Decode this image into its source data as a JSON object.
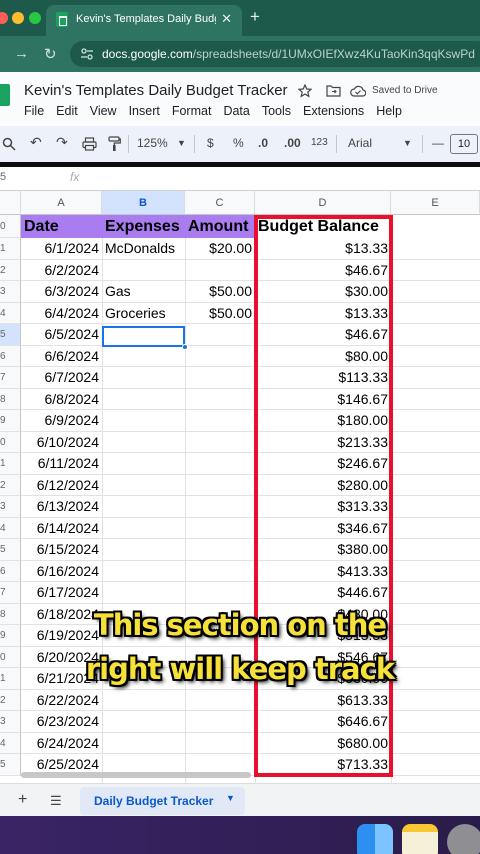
{
  "browser": {
    "tab_title": "Kevin's Templates Daily Budg",
    "tab_close": "✕",
    "new_tab": "+",
    "url_host": "docs.google.com",
    "url_path": "/spreadsheets/d/1UMxOIEfXwz4KuTaoKin3qqKswPd"
  },
  "doc": {
    "title": "Kevin's Templates Daily Budget Tracker",
    "saved_status": "Saved to Drive",
    "menu": [
      "File",
      "Edit",
      "View",
      "Insert",
      "Format",
      "Data",
      "Tools",
      "Extensions",
      "Help"
    ]
  },
  "toolbar": {
    "zoom": "125%",
    "currency": "$",
    "percent": "%",
    "decrease_decimal": ".0",
    "increase_decimal": ".00",
    "number_format": "123",
    "font": "Arial",
    "minus": "—",
    "font_size": "10"
  },
  "formula_bar": {
    "cell_ref": "5",
    "fx": "fx"
  },
  "sheet": {
    "columns": [
      "A",
      "B",
      "C",
      "D",
      "E"
    ],
    "row_numbers": [
      "0",
      "1",
      "2",
      "3",
      "4",
      "5",
      "6",
      "7",
      "8",
      "9",
      "0",
      "1",
      "2",
      "3",
      "4",
      "5",
      "6",
      "7",
      "8",
      "9",
      "0",
      "1",
      "2",
      "3",
      "4",
      "5"
    ],
    "headers": [
      "Date",
      "Expenses",
      "Amount",
      "Budget Balance"
    ],
    "rows": [
      {
        "date": "6/1/2024",
        "expense": "McDonalds",
        "amount": "$20.00",
        "balance": "$13.33"
      },
      {
        "date": "6/2/2024",
        "expense": "",
        "amount": "",
        "balance": "$46.67"
      },
      {
        "date": "6/3/2024",
        "expense": "Gas",
        "amount": "$50.00",
        "balance": "$30.00"
      },
      {
        "date": "6/4/2024",
        "expense": "Groceries",
        "amount": "$50.00",
        "balance": "$13.33"
      },
      {
        "date": "6/5/2024",
        "expense": "",
        "amount": "",
        "balance": "$46.67"
      },
      {
        "date": "6/6/2024",
        "expense": "",
        "amount": "",
        "balance": "$80.00"
      },
      {
        "date": "6/7/2024",
        "expense": "",
        "amount": "",
        "balance": "$113.33"
      },
      {
        "date": "6/8/2024",
        "expense": "",
        "amount": "",
        "balance": "$146.67"
      },
      {
        "date": "6/9/2024",
        "expense": "",
        "amount": "",
        "balance": "$180.00"
      },
      {
        "date": "6/10/2024",
        "expense": "",
        "amount": "",
        "balance": "$213.33"
      },
      {
        "date": "6/11/2024",
        "expense": "",
        "amount": "",
        "balance": "$246.67"
      },
      {
        "date": "6/12/2024",
        "expense": "",
        "amount": "",
        "balance": "$280.00"
      },
      {
        "date": "6/13/2024",
        "expense": "",
        "amount": "",
        "balance": "$313.33"
      },
      {
        "date": "6/14/2024",
        "expense": "",
        "amount": "",
        "balance": "$346.67"
      },
      {
        "date": "6/15/2024",
        "expense": "",
        "amount": "",
        "balance": "$380.00"
      },
      {
        "date": "6/16/2024",
        "expense": "",
        "amount": "",
        "balance": "$413.33"
      },
      {
        "date": "6/17/2024",
        "expense": "",
        "amount": "",
        "balance": "$446.67"
      },
      {
        "date": "6/18/2024",
        "expense": "",
        "amount": "",
        "balance": "$480.00"
      },
      {
        "date": "6/19/2024",
        "expense": "",
        "amount": "",
        "balance": "$513.33"
      },
      {
        "date": "6/20/2024",
        "expense": "",
        "amount": "",
        "balance": "$546.67"
      },
      {
        "date": "6/21/2024",
        "expense": "",
        "amount": "",
        "balance": "$580.00"
      },
      {
        "date": "6/22/2024",
        "expense": "",
        "amount": "",
        "balance": "$613.33"
      },
      {
        "date": "6/23/2024",
        "expense": "",
        "amount": "",
        "balance": "$646.67"
      },
      {
        "date": "6/24/2024",
        "expense": "",
        "amount": "",
        "balance": "$680.00"
      },
      {
        "date": "6/25/2024",
        "expense": "",
        "amount": "",
        "balance": "$713.33"
      }
    ]
  },
  "sheet_tabs": {
    "add": "+",
    "list": "☰",
    "active_tab": "Daily Budget Tracker",
    "caret": "▼"
  },
  "caption": {
    "line1": "This section on the",
    "line2": "right will keep track"
  },
  "colors": {
    "header_fill": "#a97cf0",
    "highlight_border": "#e8102c",
    "caption_text": "#f6e13a",
    "browser_tab": "#2f7363"
  },
  "icons": [
    "back-arrow-icon",
    "reload-icon",
    "site-info-icon",
    "star-icon",
    "move-to-folder-icon",
    "cloud-saved-icon",
    "search-icon",
    "undo-icon",
    "redo-icon",
    "print-icon",
    "paint-format-icon",
    "dropdown-caret-icon",
    "finder-icon",
    "notes-icon",
    "settings-icon"
  ]
}
